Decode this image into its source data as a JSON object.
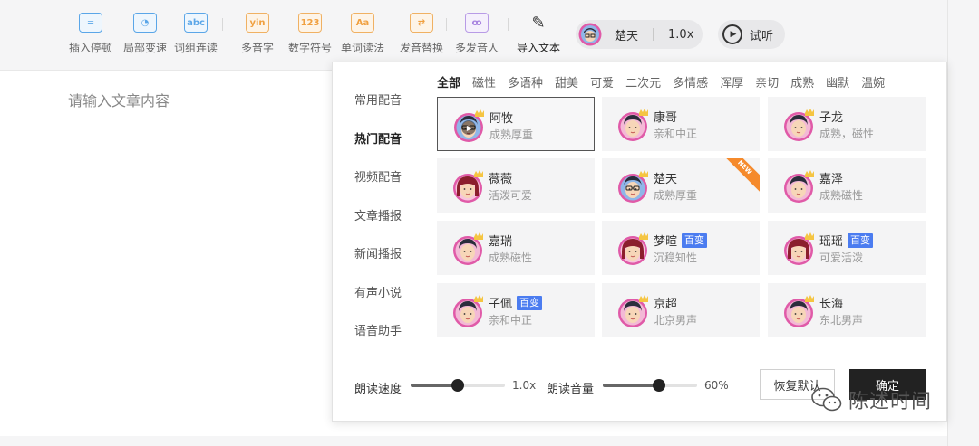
{
  "toolbar": {
    "tools": [
      {
        "label": "插入停顿",
        "icon": "pause-insert-icon",
        "glyph": "═"
      },
      {
        "label": "局部变速",
        "icon": "speed-gauge-icon",
        "glyph": "◔"
      },
      {
        "label": "词组连读",
        "icon": "abc-icon",
        "glyph": "abc"
      },
      {
        "label": "多音字",
        "icon": "yin-icon",
        "glyph": "yin"
      },
      {
        "label": "数字符号",
        "icon": "number-123-icon",
        "glyph": "123"
      },
      {
        "label": "单词读法",
        "icon": "aa-icon",
        "glyph": "Aa"
      },
      {
        "label": "发音替换",
        "icon": "swap-icon",
        "glyph": "⇄"
      },
      {
        "label": "多发音人",
        "icon": "multi-speaker-icon",
        "glyph": "ꝏ"
      },
      {
        "label": "导入文本",
        "icon": "import-text-icon",
        "glyph": "✎"
      }
    ],
    "current_voice": {
      "name": "楚天",
      "speed": "1.0x"
    },
    "listen_label": "试听"
  },
  "editor": {
    "placeholder": "请输入文章内容"
  },
  "popup": {
    "categories": [
      "常用配音",
      "热门配音",
      "视频配音",
      "文章播报",
      "新闻播报",
      "有声小说",
      "语音助手"
    ],
    "active_category": "热门配音",
    "filters": [
      "全部",
      "磁性",
      "多语种",
      "甜美",
      "可爱",
      "二次元",
      "多情感",
      "浑厚",
      "亲切",
      "成熟",
      "幽默",
      "温婉"
    ],
    "active_filter": "全部",
    "voices": [
      {
        "name": "阿牧",
        "desc": "成熟厚重",
        "badge": "",
        "avatar": "glasses",
        "selected": true,
        "new": false
      },
      {
        "name": "康哥",
        "desc": "亲和中正",
        "badge": "",
        "avatar": "male",
        "selected": false,
        "new": false
      },
      {
        "name": "子龙",
        "desc": "成熟，磁性",
        "badge": "",
        "avatar": "male",
        "selected": false,
        "new": false
      },
      {
        "name": "薇薇",
        "desc": "活泼可爱",
        "badge": "",
        "avatar": "female",
        "selected": false,
        "new": false
      },
      {
        "name": "楚天",
        "desc": "成熟厚重",
        "badge": "",
        "avatar": "glasses",
        "selected": false,
        "new": true
      },
      {
        "name": "嘉泽",
        "desc": "成熟磁性",
        "badge": "",
        "avatar": "male",
        "selected": false,
        "new": false
      },
      {
        "name": "嘉瑞",
        "desc": "成熟磁性",
        "badge": "",
        "avatar": "male",
        "selected": false,
        "new": false
      },
      {
        "name": "梦暄",
        "desc": "沉稳知性",
        "badge": "百变",
        "avatar": "female",
        "selected": false,
        "new": false
      },
      {
        "name": "瑶瑶",
        "desc": "可爱活泼",
        "badge": "百变",
        "avatar": "female",
        "selected": false,
        "new": false
      },
      {
        "name": "子佩",
        "desc": "亲和中正",
        "badge": "百变",
        "avatar": "male",
        "selected": false,
        "new": false
      },
      {
        "name": "京超",
        "desc": "北京男声",
        "badge": "",
        "avatar": "male",
        "selected": false,
        "new": false
      },
      {
        "name": "长海",
        "desc": "东北男声",
        "badge": "",
        "avatar": "male",
        "selected": false,
        "new": false
      }
    ],
    "new_label": "NEW",
    "speed": {
      "label": "朗读速度",
      "value": "1.0x",
      "level": 0.5
    },
    "volume": {
      "label": "朗读音量",
      "value": "60%",
      "level": 0.6
    },
    "reset_label": "恢复默认",
    "ok_label": "确定"
  },
  "watermark": {
    "text": "陈述时间",
    "icon": "wechat-icon"
  },
  "colors": {
    "accent": "#222222",
    "badge": "#4b7cf0",
    "new_ribbon": "#f58a2c",
    "crown": "#f5c542",
    "avatar_ring": "#e05aa8"
  }
}
